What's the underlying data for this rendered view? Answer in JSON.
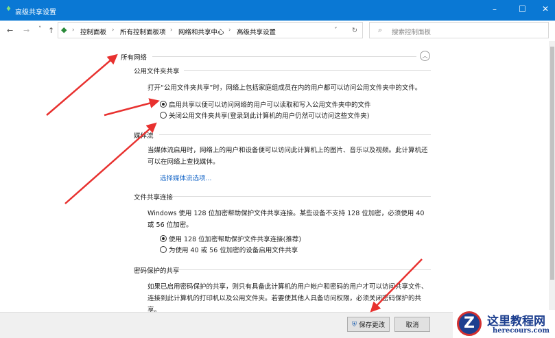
{
  "window": {
    "title": "高级共享设置",
    "minimize": "–",
    "maximize": "☐",
    "close": "✕"
  },
  "nav": {
    "back": "←",
    "forward": "→",
    "recent": "˅",
    "up": "↑",
    "breadcrumbs": [
      "控制面板",
      "所有控制面板项",
      "网络和共享中心",
      "高级共享设置"
    ],
    "dropdown": "˅",
    "refresh": "↻",
    "search_placeholder": "搜索控制面板"
  },
  "content": {
    "all_networks": "所有网络",
    "public_folder": {
      "heading": "公用文件夹共享",
      "desc": "打开“公用文件夹共享”时，网络上包括家庭组成员在内的用户都可以访问公用文件夹中的文件。",
      "options": [
        "启用共享以便可以访问网络的用户可以读取和写入公用文件夹中的文件",
        "关闭公用文件夹共享(登录到此计算机的用户仍然可以访问这些文件夹)"
      ],
      "selected": 0
    },
    "media": {
      "heading": "媒体流",
      "desc": "当媒体流启用时，网络上的用户和设备便可以访问此计算机上的图片、音乐以及视频。此计算机还可以在网络上查找媒体。",
      "link": "选择媒体流选项..."
    },
    "file_sharing": {
      "heading": "文件共享连接",
      "desc": "Windows 使用 128 位加密帮助保护文件共享连接。某些设备不支持 128 位加密，必须使用 40 或 56 位加密。",
      "options": [
        "使用 128 位加密帮助保护文件共享连接(推荐)",
        "为使用 40 或 56 位加密的设备启用文件共享"
      ],
      "selected": 0
    },
    "password": {
      "heading": "密码保护的共享",
      "desc": "如果已启用密码保护的共享，则只有具备此计算机的用户帐户和密码的用户才可以访问共享文件、连接到此计算机的打印机以及公用文件夹。若要使其他人具备访问权限，必须关闭密码保护的共享。"
    }
  },
  "footer": {
    "save": "保存更改",
    "cancel": "取消"
  },
  "watermark": {
    "name": "这里教程网",
    "url": "herecours.com"
  },
  "colors": {
    "titlebar": "#0a78d4",
    "link": "#1b6ac9",
    "arrow": "#e8312f"
  }
}
